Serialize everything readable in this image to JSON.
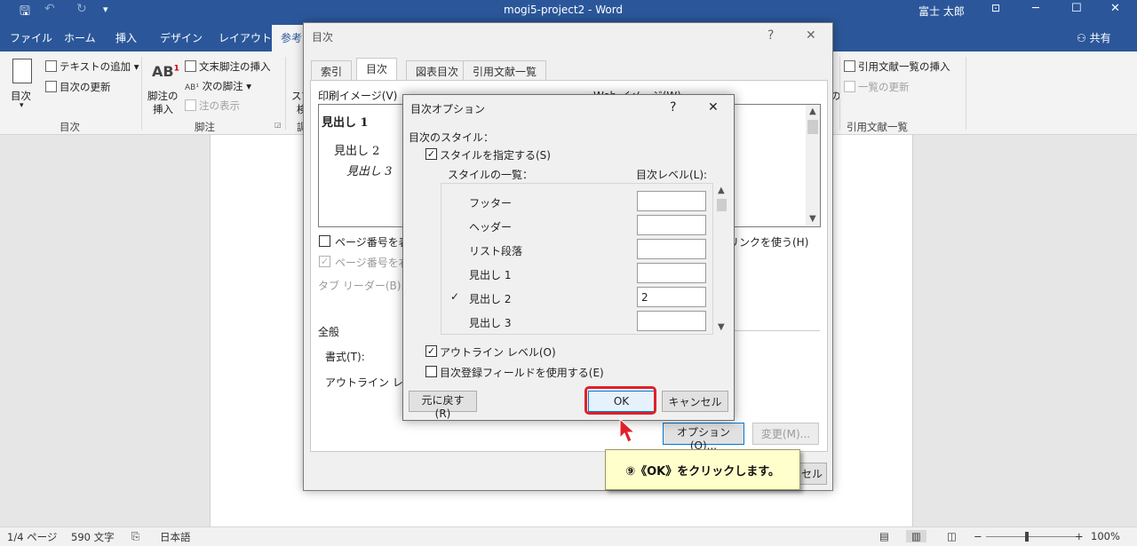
{
  "title_bar": {
    "doc_title": "mogi5-project2 - Word",
    "user": "富士 太郎",
    "save_glyph": "🖫",
    "undo_glyph": "↶",
    "redo_glyph": "↻",
    "qa_glyph": "▾",
    "min_glyph": "─",
    "restore_glyph": "☐",
    "close_glyph": "✕"
  },
  "ribbon_tabs": [
    "ファイル",
    "ホーム",
    "挿入",
    "デザイン",
    "レイアウト",
    "参考"
  ],
  "share_label": "共有",
  "ribbon": {
    "toc_group": {
      "toc_button": "目次",
      "add_text": "テキストの追加",
      "update_toc": "目次の更新",
      "title": "目次"
    },
    "footnote_group": {
      "insert_footnote_1": "脚注の",
      "insert_footnote_2": "挿入",
      "ab_glyph": "AB",
      "insert_endnote": "文末脚注の挿入",
      "next_footnote": "次の脚注",
      "show_notes": "注の表示",
      "title": "脚注"
    },
    "research_partial": {
      "line1": "スマ",
      "line2": "検",
      "line3": "調"
    },
    "citation_group": {
      "insert_toa": "引用文献一覧の挿入",
      "update_table": "一覧の更新",
      "title": "引用文献一覧",
      "partial": "の"
    }
  },
  "status_bar": {
    "page": "1/4 ページ",
    "words": "590 文字",
    "lang": "日本語",
    "zoom": "100%",
    "minus": "−",
    "plus": "+"
  },
  "toc_dialog": {
    "title": "目次",
    "help": "?",
    "close": "✕",
    "tabs": [
      "索引",
      "目次",
      "図表目次",
      "引用文献一覧"
    ],
    "print_preview_label": "印刷イメージ(V)",
    "web_preview_label": "Web イメージ(W)",
    "preview": {
      "h1": "見出し 1",
      "h2": "見出し 2",
      "h3": "見出し 3"
    },
    "show_page_numbers": "ページ番号を表示",
    "right_align": "ページ番号を右揃",
    "tab_leader": "タブ リーダー(B):",
    "use_hyperlinks": "リンクを使う(H)",
    "general": "全般",
    "formats": "書式(T):",
    "outline_levels": "アウトライン レベル",
    "options_button": "オプション(O)...",
    "modify_button": "変更(M)...",
    "cancel_partial": "セル"
  },
  "options_dialog": {
    "title": "目次オプション",
    "help": "?",
    "close": "✕",
    "build_from": "目次のスタイル：",
    "styles_checkbox": "スタイルを指定する(S)",
    "available_styles": "スタイルの一覧：",
    "toc_level": "目次レベル(L):",
    "styles": [
      {
        "name": "フッター",
        "level": "",
        "checked": ""
      },
      {
        "name": "ヘッダー",
        "level": "",
        "checked": ""
      },
      {
        "name": "リスト段落",
        "level": "",
        "checked": ""
      },
      {
        "name": "見出し 1",
        "level": "",
        "checked": ""
      },
      {
        "name": "見出し 2",
        "level": "2",
        "checked": "✓"
      },
      {
        "name": "見出し 3",
        "level": "",
        "checked": ""
      }
    ],
    "outline_checkbox": "アウトライン レベル(O)",
    "fields_checkbox": "目次登録フィールドを使用する(E)",
    "reset_button": "元に戻す(R)",
    "ok_button": "OK",
    "cancel_button": "キャンセル"
  },
  "callout": {
    "text": "⑨《OK》をクリックします。"
  }
}
